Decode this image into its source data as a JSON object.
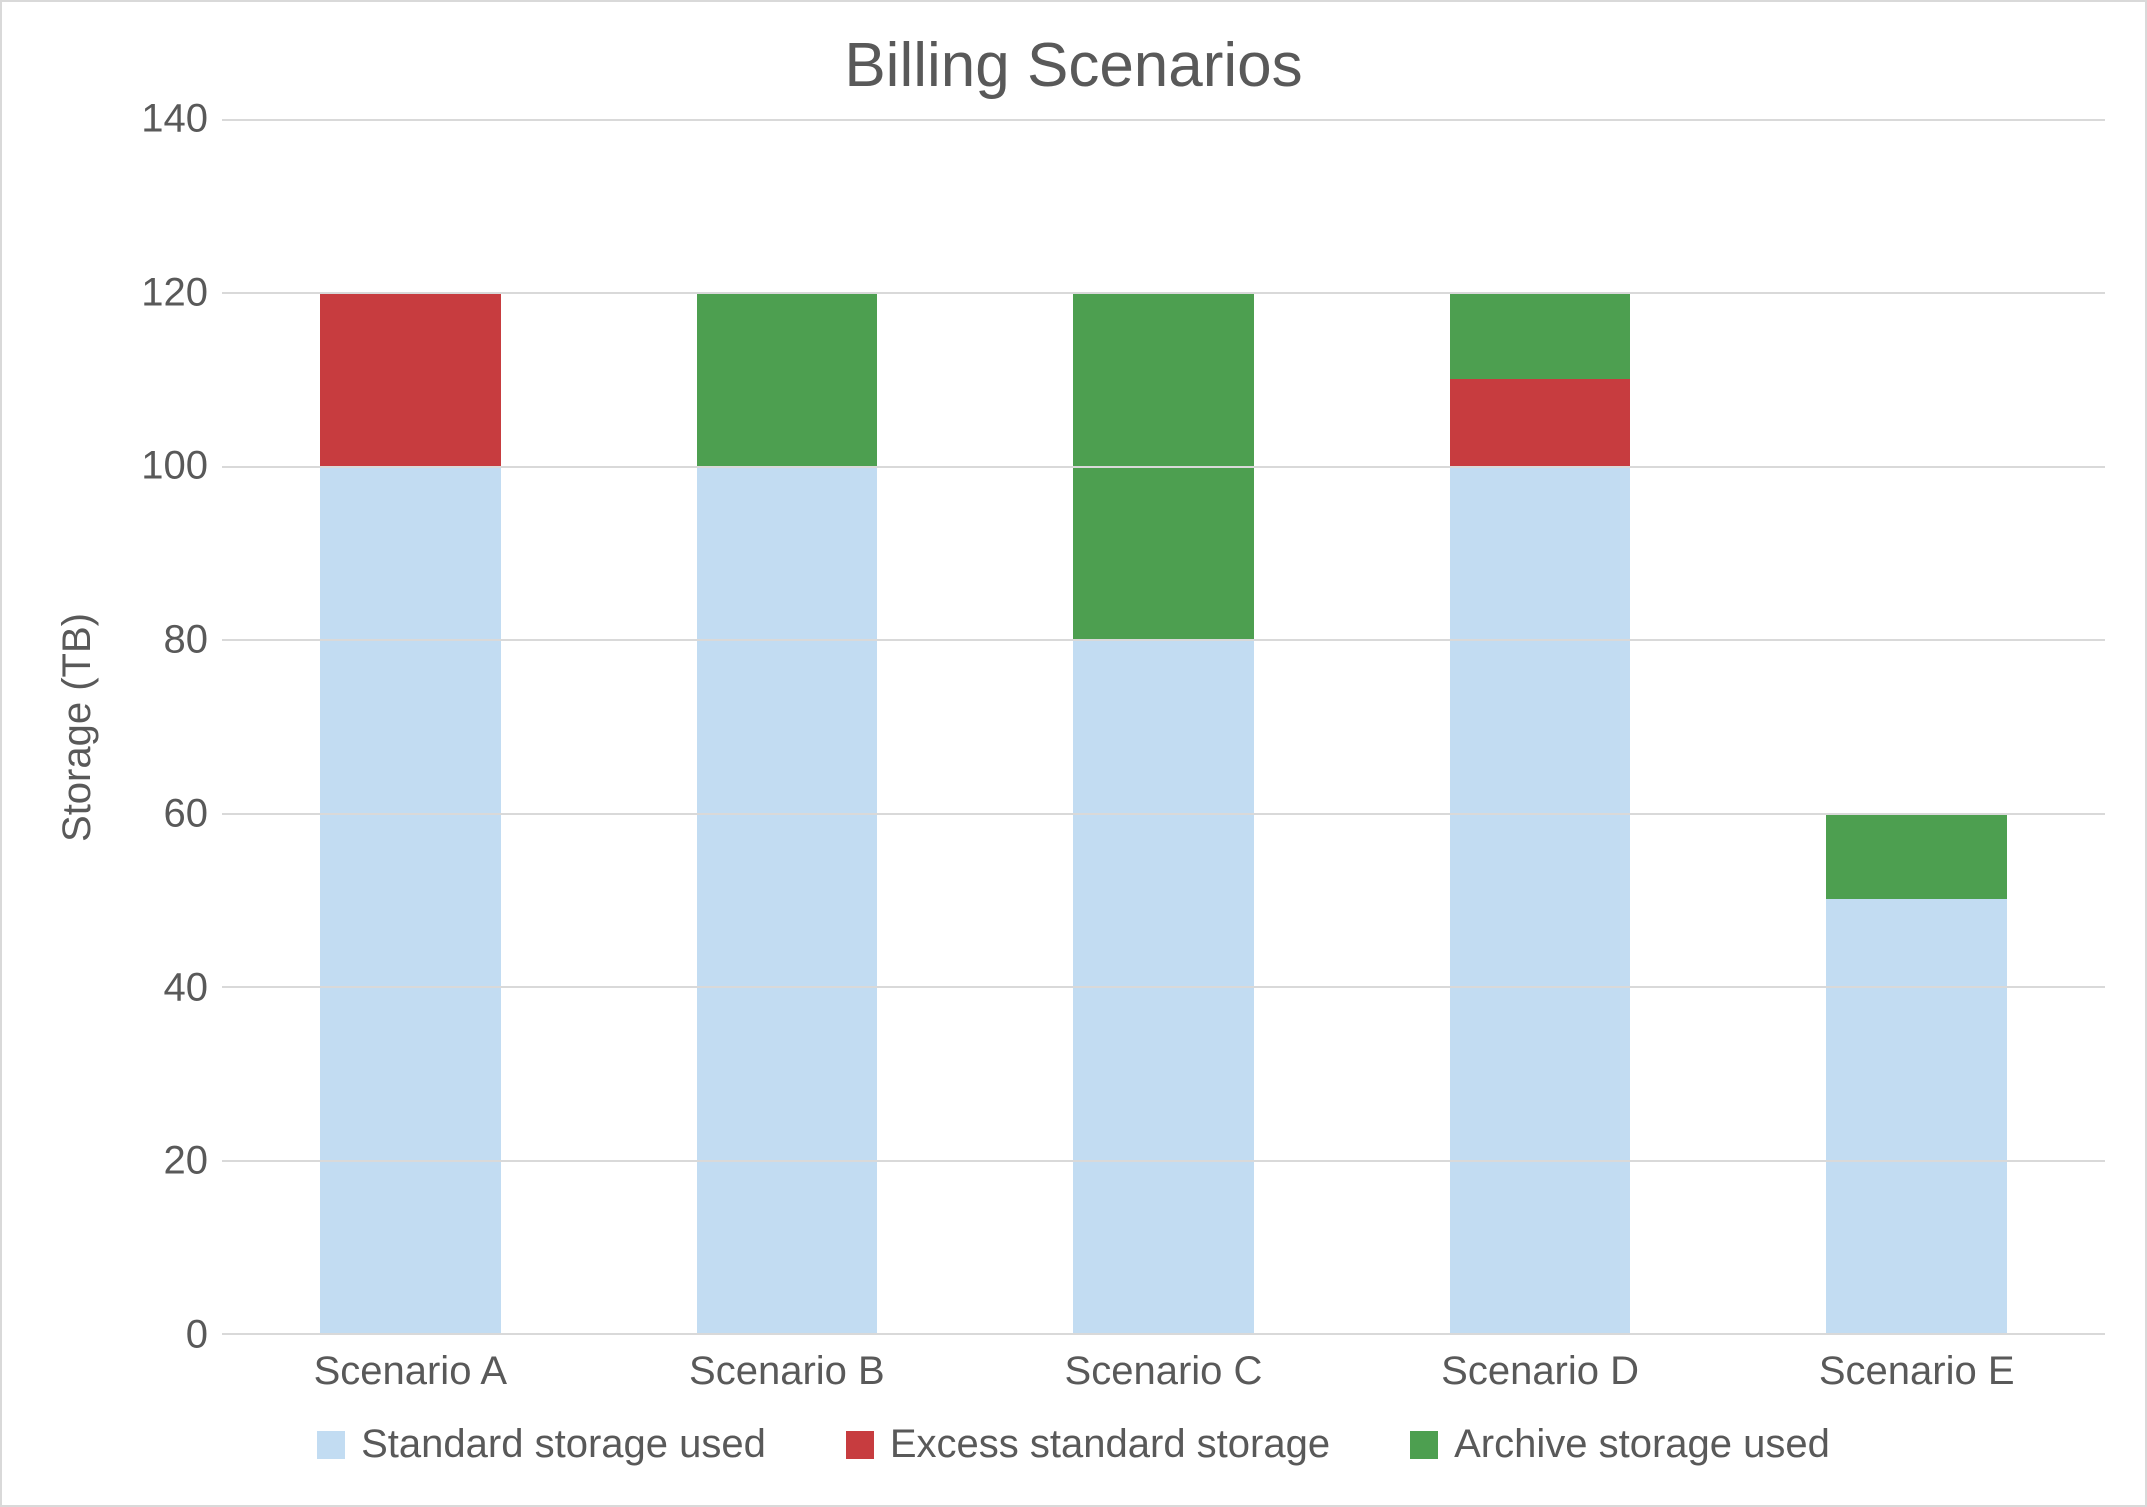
{
  "chart_data": {
    "type": "bar",
    "stacked": true,
    "title": "Billing Scenarios",
    "ylabel": "Storage (TB)",
    "xlabel": "",
    "ylim": [
      0,
      140
    ],
    "y_ticks": [
      0,
      20,
      40,
      60,
      80,
      100,
      120,
      140
    ],
    "categories": [
      "Scenario A",
      "Scenario B",
      "Scenario C",
      "Scenario D",
      "Scenario E"
    ],
    "series": [
      {
        "name": "Standard storage used",
        "color": "#c2dcf2",
        "values": [
          100,
          100,
          80,
          100,
          50
        ]
      },
      {
        "name": "Excess standard storage",
        "color": "#c73c3f",
        "values": [
          20,
          0,
          0,
          10,
          0
        ]
      },
      {
        "name": "Archive storage used",
        "color": "#4d9f50",
        "values": [
          0,
          20,
          40,
          10,
          10
        ]
      }
    ],
    "legend_position": "bottom",
    "grid": true
  }
}
